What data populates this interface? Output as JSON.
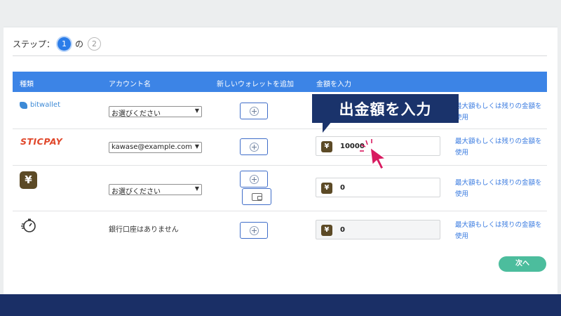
{
  "stepper": {
    "label": "ステップ：",
    "current": "1",
    "separator": "の",
    "total": "2"
  },
  "table": {
    "headers": {
      "type": "種類",
      "account": "アカウント名",
      "new_wallet": "新しいウォレットを追加",
      "amount": "金額を入力"
    },
    "rows": [
      {
        "type_label": "bitwallet",
        "type_icon": "bitwallet-logo",
        "account": "お選びください",
        "amount": "",
        "max_link": "最大額もしくは残りの金額を使用"
      },
      {
        "type_label": "STICPAY",
        "type_icon": "sticpay-logo",
        "account": "kawase@example.com",
        "amount": "10000",
        "max_link": "最大額もしくは残りの金額を使用"
      },
      {
        "type_label": "¥",
        "type_icon": "yen-logo",
        "account": "お選びください",
        "amount": "0",
        "max_link": "最大額もしくは残りの金額を使用"
      },
      {
        "type_icon": "stopwatch-logo",
        "account": "銀行口座はありません",
        "amount": "0",
        "max_link": "最大額もしくは残りの金額を使用"
      }
    ],
    "currency_symbol": "¥"
  },
  "callout": {
    "text": "出金額を入力"
  },
  "next_button": {
    "label": "次へ"
  },
  "icons": {
    "add": "plus-circle-icon",
    "wallet": "wallet-icon",
    "cursor": "hand-pointer-icon",
    "select": "chevron-down-icon"
  },
  "colors": {
    "header_blue": "#3c84e6",
    "callout_navy": "#1a336b",
    "next_green": "#4cbd9d",
    "link_blue": "#3a7be0",
    "yen_brown": "#5c4a26",
    "sticpay_red": "#e0472a",
    "cursor_pink": "#d81b60"
  }
}
